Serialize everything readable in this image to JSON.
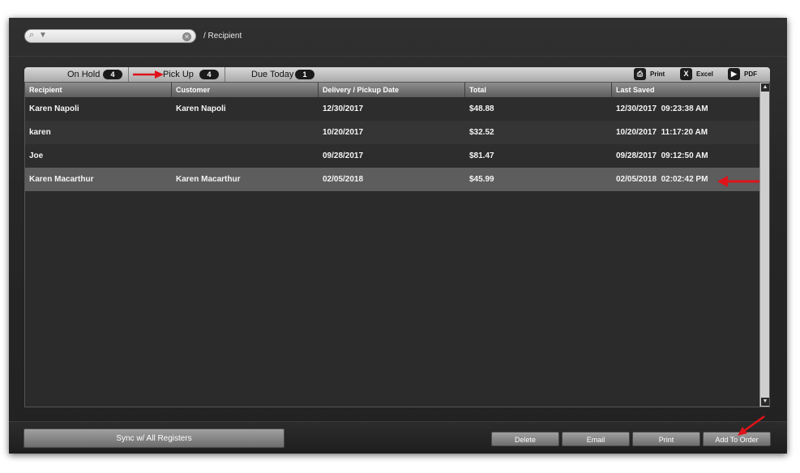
{
  "search": {
    "value": "",
    "placeholder": ""
  },
  "breadcrumb": "/ Recipient",
  "tabs": [
    {
      "label": "On Hold",
      "count": "4"
    },
    {
      "label": "Pick Up",
      "count": "4"
    },
    {
      "label": "Due Today",
      "count": "1"
    }
  ],
  "export": {
    "print": "Print",
    "excel": "Excel",
    "pdf": "PDF"
  },
  "table": {
    "columns": [
      "Recipient",
      "Customer",
      "Delivery / Pickup Date",
      "Total",
      "Last Saved"
    ],
    "rows": [
      [
        "Karen Napoli",
        "Karen Napoli",
        "12/30/2017",
        "$48.88",
        "12/30/2017  09:23:38 AM"
      ],
      [
        "karen",
        "",
        "10/20/2017",
        "$32.52",
        "10/20/2017  11:17:20 AM"
      ],
      [
        "Joe",
        "",
        "09/28/2017",
        "$81.47",
        "09/28/2017  09:12:50 AM"
      ],
      [
        "Karen Macarthur",
        "Karen Macarthur",
        "02/05/2018",
        "$45.99",
        "02/05/2018  02:02:42 PM"
      ]
    ]
  },
  "buttons": {
    "sync": "Sync w/ All Registers",
    "delete": "Delete",
    "email": "Email",
    "print": "Print",
    "add_to_order": "Add To Order"
  },
  "colors": {
    "annotation_arrow": "#e0131a"
  }
}
